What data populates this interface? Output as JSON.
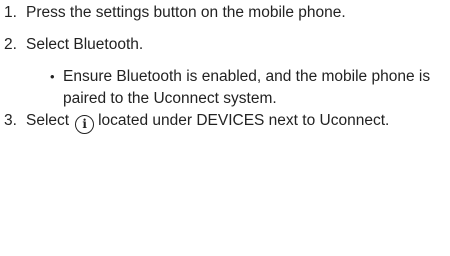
{
  "steps": [
    {
      "number": "1.",
      "text": "Press the settings button on the mobile phone."
    },
    {
      "number": "2.",
      "text": "Select Bluetooth."
    },
    {
      "number": "3.",
      "text_before": "Select",
      "icon": "info-icon",
      "icon_glyph": "i",
      "text_after": "located under DEVICES next to Uconnect."
    }
  ],
  "bullets": [
    {
      "marker": "•",
      "text": "Ensure Bluetooth is enabled, and the mobile phone is paired to the Uconnect system."
    }
  ]
}
